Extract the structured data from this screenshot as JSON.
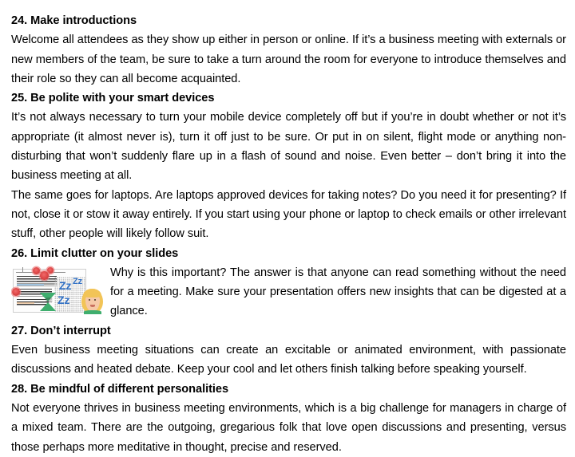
{
  "document": {
    "sections": [
      {
        "heading": "24. Make introductions",
        "paragraphs": [
          "Welcome all attendees as they show up either in person or online. If it’s a business meeting with externals or new members of the team, be sure to take a turn around the room for everyone to introduce themselves and their role so they can all become acquainted."
        ]
      },
      {
        "heading": "25. Be polite with your smart devices",
        "paragraphs": [
          "It’s not always necessary to turn your mobile device completely off but if you’re in doubt whether or not it’s appropriate (it almost never is), turn it off just to be sure. Or put in on silent, flight mode or anything non-disturbing that won’t suddenly flare up in a flash of sound and noise. Even better – don’t bring it into the business meeting at all.",
          "The same goes for laptops. Are laptops approved devices for taking notes? Do you need it for presenting? If not, close it or stow it away entirely. If you start using your phone or laptop to check emails or other irrelevant stuff, other people will likely follow suit."
        ]
      },
      {
        "heading": "26. Limit clutter on your slides",
        "paragraphs": [
          "Why is this important? The answer is that anyone can read something without the need for a meeting. Make sure your presentation offers new insights that can be digested at a glance."
        ]
      },
      {
        "heading": "27. Don’t interrupt",
        "paragraphs": [
          "Even business meeting situations can create an excitable or animated environment, with passionate discussions and heated debate. Keep your cool and let others finish talking before speaking yourself."
        ]
      },
      {
        "heading": "28. Be mindful of different personalities",
        "paragraphs": [
          "Not everyone thrives in business meeting environments, which is a big challenge for managers in charge of a mixed team. There are the outgoing, gregarious folk that love open discussions and presenting, versus those perhaps more meditative in thought, precise and reserved."
        ]
      }
    ]
  },
  "figure": {
    "caption_zz_1": "Zz",
    "caption_zz_2": "Zz",
    "caption_zz_3": "Zz",
    "hourglass_glyphs": "▒▒",
    "colors": {
      "zz_blue": "#2f6fc4",
      "flower_red": "#e04a4a",
      "hourglass_green": "#3fae6e",
      "hair_yellow": "#f2c457",
      "skin": "#f6c9a8"
    }
  }
}
